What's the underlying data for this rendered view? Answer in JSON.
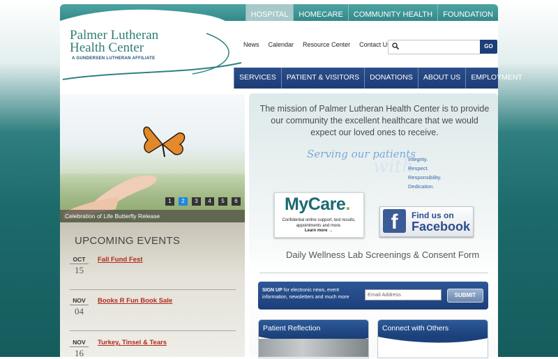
{
  "topnav": {
    "items": [
      "HOSPITAL",
      "HOMECARE",
      "COMMUNITY HEALTH",
      "FOUNDATION"
    ],
    "active": "HOSPITAL"
  },
  "logo": {
    "line1": "Palmer Lutheran",
    "line2": "Health Center",
    "sub": "A GUNDERSEN LUTHERAN AFFILIATE"
  },
  "utilnav": {
    "items": [
      "News",
      "Calendar",
      "Resource Center",
      "Contact Us"
    ]
  },
  "search": {
    "placeholder": "",
    "go_label": "GO"
  },
  "mainnav": {
    "items": [
      "SERVICES",
      "PATIENT & VISITORS",
      "DONATIONS",
      "ABOUT US",
      "EMPLOYMENT"
    ]
  },
  "hero": {
    "caption": "Celebration of Life Butterfly Release",
    "slides": [
      "1",
      "2",
      "3",
      "4",
      "5",
      "6"
    ],
    "active_slide": "2"
  },
  "events": {
    "title": "UPCOMING EVENTS",
    "items": [
      {
        "month": "OCT",
        "day": "15",
        "name": "Fall Fund Fest"
      },
      {
        "month": "NOV",
        "day": "04",
        "name": "Books R Fun Book Sale"
      },
      {
        "month": "NOV",
        "day": "16",
        "name": "Turkey, Tinsel & Tears"
      }
    ]
  },
  "mission": {
    "text": "The mission of Palmer Lutheran Health Center is to provide our community the excellent healthcare that we would expect our loved ones to receive.",
    "serving": "Serving our patients",
    "with": "with",
    "values": [
      "Integrity.",
      "Respect.",
      "Responsibility.",
      "Dedication."
    ]
  },
  "mycare": {
    "logo_a": "MyCare",
    "logo_b": ".",
    "text": "Confidential online support, test results, appointments and more.",
    "link": "Learn more →"
  },
  "facebook": {
    "f": "f",
    "line1": "Find us on",
    "line2": "Facebook"
  },
  "daily_link": "Daily Wellness Lab Screenings & Consent Form",
  "signup": {
    "bold": "SIGN UP",
    "text": " for electronic news, event information, newsletters and much more",
    "email_placeholder": "Email Address",
    "submit_label": "SUBMIT"
  },
  "boxes": {
    "left_title": "Patient Reflection",
    "right_title": "Connect with Others"
  },
  "colors": {
    "teal": "#2d8283",
    "navy": "#1c3c74",
    "event_red": "#b22a1c"
  }
}
